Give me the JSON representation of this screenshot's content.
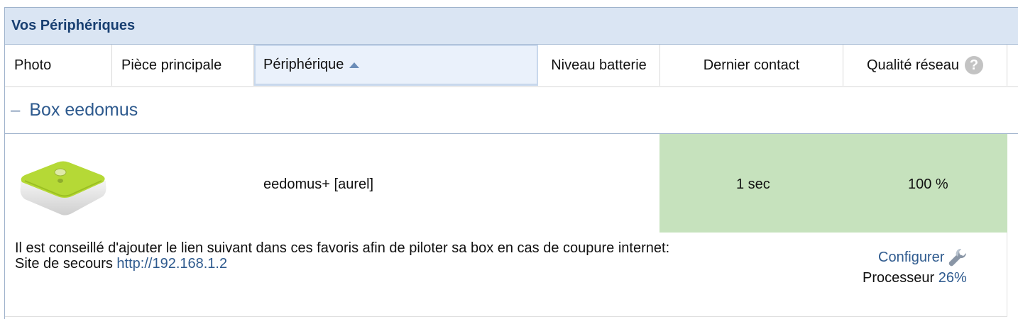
{
  "panel": {
    "title": "Vos Périphériques"
  },
  "columns": {
    "photo": "Photo",
    "room": "Pièce principale",
    "device": "Périphérique",
    "battery": "Niveau batterie",
    "last_contact": "Dernier contact",
    "network_quality": "Qualité réseau"
  },
  "help_icon_label": "?",
  "group": {
    "toggle": "–",
    "label": "Box eedomus"
  },
  "device": {
    "name": "eedomus+ [aurel]",
    "last_contact": "1 sec",
    "network_quality": "100 %",
    "note_line1": "Il est conseillé d'ajouter le lien suivant dans ces favoris afin de piloter sa box en cas de coupure internet:",
    "backup_label": "Site de secours ",
    "backup_url": "http://192.168.1.2",
    "configure": "Configurer",
    "cpu_label": "Processeur ",
    "cpu_value": "26%"
  },
  "colors": {
    "header_bg": "#dae5f3",
    "title": "#183f71",
    "link": "#2e5a8e",
    "status_ok": "#c6e2bd",
    "device_lime": "#b5d936"
  }
}
